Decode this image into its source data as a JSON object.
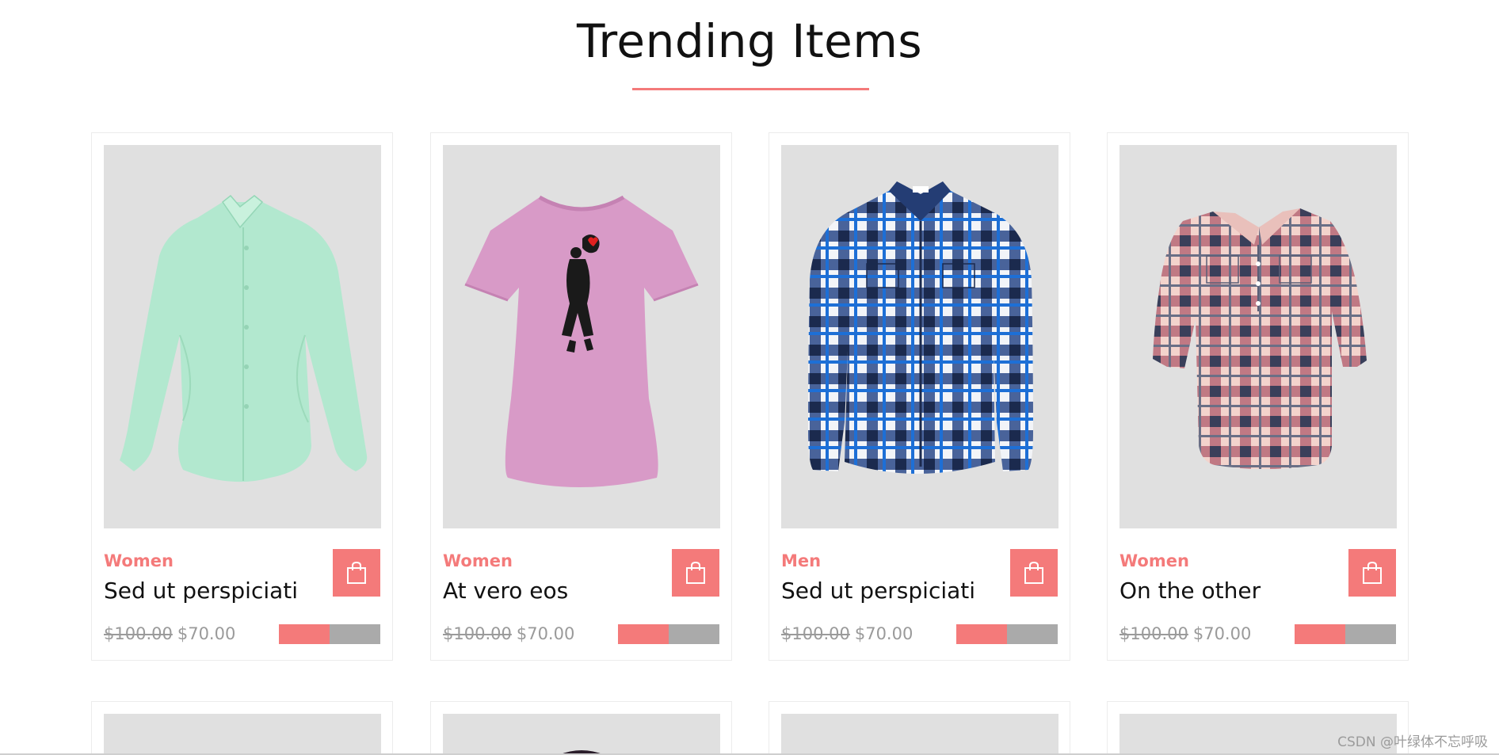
{
  "section": {
    "title": "Trending Items"
  },
  "colors": {
    "accent": "#f47a7a",
    "image_bg": "#e0e0e0",
    "price_gray": "#9a9a9a",
    "rating_track": "#aaaaaa"
  },
  "products": [
    {
      "category": "Women",
      "name": "Sed ut perspiciati",
      "old_price": "$100.00",
      "new_price": "$70.00",
      "rating_fraction": 0.5,
      "image": "mint-green-womens-shirt",
      "cart_icon": "shopping-bag-icon"
    },
    {
      "category": "Women",
      "name": "At vero eos",
      "old_price": "$100.00",
      "new_price": "$70.00",
      "rating_fraction": 0.5,
      "image": "pink-graphic-tshirt",
      "cart_icon": "shopping-bag-icon"
    },
    {
      "category": "Men",
      "name": "Sed ut perspiciati",
      "old_price": "$100.00",
      "new_price": "$70.00",
      "rating_fraction": 0.5,
      "image": "blue-plaid-mens-shirt",
      "cart_icon": "shopping-bag-icon"
    },
    {
      "category": "Women",
      "name": "On the other",
      "old_price": "$100.00",
      "new_price": "$70.00",
      "rating_fraction": 0.5,
      "image": "pink-plaid-womens-shirt",
      "cart_icon": "shopping-bag-icon"
    }
  ],
  "watermark": "CSDN @叶绿体不忘呼吸"
}
